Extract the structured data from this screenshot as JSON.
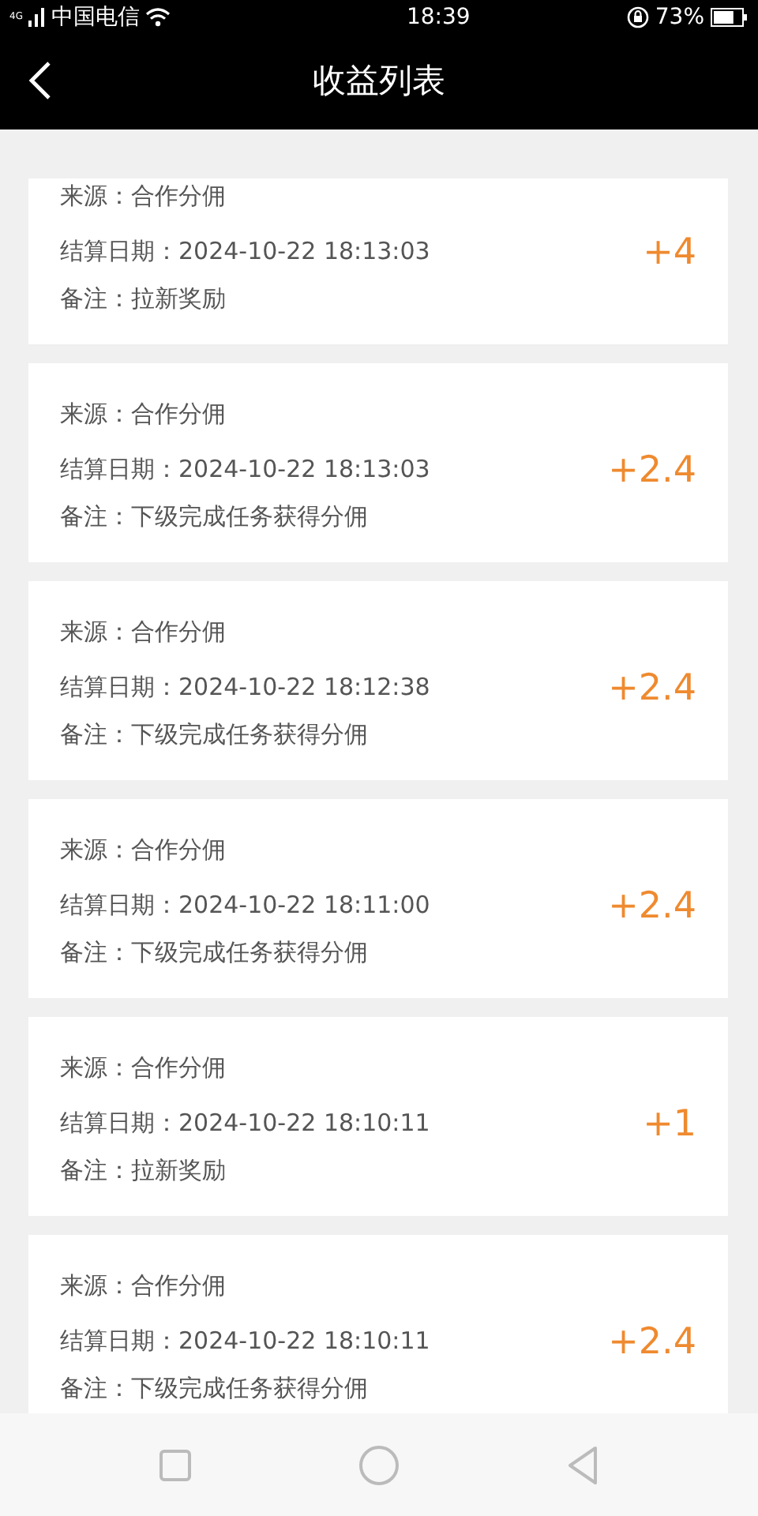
{
  "status_bar": {
    "carrier": "中国电信",
    "network": "4G",
    "time": "18:39",
    "battery_text": "73%"
  },
  "header": {
    "title": "收益列表"
  },
  "records": [
    {
      "source": "来源：合作分佣",
      "date": "结算日期：2024-10-22 18:13:03",
      "note": "备注：拉新奖励",
      "amount": "+4"
    },
    {
      "source": "来源：合作分佣",
      "date": "结算日期：2024-10-22 18:13:03",
      "note": "备注：下级完成任务获得分佣",
      "amount": "+2.4"
    },
    {
      "source": "来源：合作分佣",
      "date": "结算日期：2024-10-22 18:12:38",
      "note": "备注：下级完成任务获得分佣",
      "amount": "+2.4"
    },
    {
      "source": "来源：合作分佣",
      "date": "结算日期：2024-10-22 18:11:00",
      "note": "备注：下级完成任务获得分佣",
      "amount": "+2.4"
    },
    {
      "source": "来源：合作分佣",
      "date": "结算日期：2024-10-22 18:10:11",
      "note": "备注：拉新奖励",
      "amount": "+1"
    },
    {
      "source": "来源：合作分佣",
      "date": "结算日期：2024-10-22 18:10:11",
      "note": "备注：下级完成任务获得分佣",
      "amount": "+2.4"
    }
  ]
}
